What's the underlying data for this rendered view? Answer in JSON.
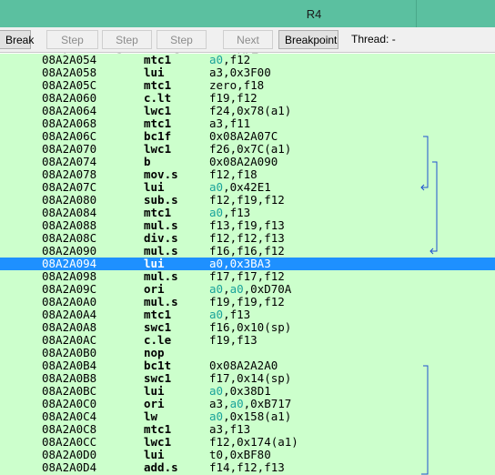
{
  "window": {
    "title": "R4"
  },
  "toolbar": {
    "break": "Break",
    "step_into": "Step Into",
    "step_over": "Step Over",
    "step_out": "Step Out",
    "next_hle": "Next HLE",
    "breakpoint": "Breakpoint",
    "thread_label": "Thread: -"
  },
  "colors": {
    "listing_bg": "#ccffcc",
    "selected_bg": "#1e90ff",
    "register": "#1aa39a",
    "arrow": "#2050d0",
    "titlebar": "#5bc0a0"
  },
  "rows": [
    {
      "addr": "08A2A054",
      "mn": "mtc1",
      "ops": [
        {
          "t": "a0",
          "r": true
        },
        {
          "t": ",f12"
        }
      ]
    },
    {
      "addr": "08A2A058",
      "mn": "lui",
      "ops": [
        {
          "t": "a3,0x3F00"
        }
      ]
    },
    {
      "addr": "08A2A05C",
      "mn": "mtc1",
      "ops": [
        {
          "t": "zero,f18"
        }
      ]
    },
    {
      "addr": "08A2A060",
      "mn": "c.lt",
      "ops": [
        {
          "t": "f19,f12"
        }
      ]
    },
    {
      "addr": "08A2A064",
      "mn": "lwc1",
      "ops": [
        {
          "t": "f24,0x78(a1)"
        }
      ]
    },
    {
      "addr": "08A2A068",
      "mn": "mtc1",
      "ops": [
        {
          "t": "a3,f11"
        }
      ]
    },
    {
      "addr": "08A2A06C",
      "mn": "bc1f",
      "ops": [
        {
          "t": "0x08A2A07C"
        }
      ]
    },
    {
      "addr": "08A2A070",
      "mn": "lwc1",
      "ops": [
        {
          "t": "f26,0x7C(a1)"
        }
      ]
    },
    {
      "addr": "08A2A074",
      "mn": "b",
      "ops": [
        {
          "t": "0x08A2A090"
        }
      ]
    },
    {
      "addr": "08A2A078",
      "mn": "mov.s",
      "ops": [
        {
          "t": "f12,f18"
        }
      ]
    },
    {
      "addr": "08A2A07C",
      "mn": "lui",
      "ops": [
        {
          "t": "a0",
          "r": true
        },
        {
          "t": ",0x42E1"
        }
      ]
    },
    {
      "addr": "08A2A080",
      "mn": "sub.s",
      "ops": [
        {
          "t": "f12,f19,f12"
        }
      ]
    },
    {
      "addr": "08A2A084",
      "mn": "mtc1",
      "ops": [
        {
          "t": "a0",
          "r": true
        },
        {
          "t": ",f13"
        }
      ]
    },
    {
      "addr": "08A2A088",
      "mn": "mul.s",
      "ops": [
        {
          "t": "f13,f19,f13"
        }
      ]
    },
    {
      "addr": "08A2A08C",
      "mn": "div.s",
      "ops": [
        {
          "t": "f12,f12,f13"
        }
      ]
    },
    {
      "addr": "08A2A090",
      "mn": "mul.s",
      "ops": [
        {
          "t": "f16,f16,f12"
        }
      ]
    },
    {
      "addr": "08A2A094",
      "mn": "lui",
      "ops": [
        {
          "t": "a0,0x3BA3"
        }
      ],
      "selected": true
    },
    {
      "addr": "08A2A098",
      "mn": "mul.s",
      "ops": [
        {
          "t": "f17,f17,f12"
        }
      ]
    },
    {
      "addr": "08A2A09C",
      "mn": "ori",
      "ops": [
        {
          "t": "a0",
          "r": true
        },
        {
          "t": ","
        },
        {
          "t": "a0",
          "r": true
        },
        {
          "t": ",0xD70A"
        }
      ]
    },
    {
      "addr": "08A2A0A0",
      "mn": "mul.s",
      "ops": [
        {
          "t": "f19,f19,f12"
        }
      ]
    },
    {
      "addr": "08A2A0A4",
      "mn": "mtc1",
      "ops": [
        {
          "t": "a0",
          "r": true
        },
        {
          "t": ",f13"
        }
      ]
    },
    {
      "addr": "08A2A0A8",
      "mn": "swc1",
      "ops": [
        {
          "t": "f16,0x10(sp)"
        }
      ]
    },
    {
      "addr": "08A2A0AC",
      "mn": "c.le",
      "ops": [
        {
          "t": "f19,f13"
        }
      ]
    },
    {
      "addr": "08A2A0B0",
      "mn": "nop",
      "ops": []
    },
    {
      "addr": "08A2A0B4",
      "mn": "bc1t",
      "ops": [
        {
          "t": "0x08A2A2A0"
        }
      ]
    },
    {
      "addr": "08A2A0B8",
      "mn": "swc1",
      "ops": [
        {
          "t": "f17,0x14(sp)"
        }
      ]
    },
    {
      "addr": "08A2A0BC",
      "mn": "lui",
      "ops": [
        {
          "t": "a0",
          "r": true
        },
        {
          "t": ",0x38D1"
        }
      ]
    },
    {
      "addr": "08A2A0C0",
      "mn": "ori",
      "ops": [
        {
          "t": "a3,"
        },
        {
          "t": "a0",
          "r": true
        },
        {
          "t": ",0xB717"
        }
      ]
    },
    {
      "addr": "08A2A0C4",
      "mn": "lw",
      "ops": [
        {
          "t": "a0",
          "r": true
        },
        {
          "t": ",0x158(a1)"
        }
      ]
    },
    {
      "addr": "08A2A0C8",
      "mn": "mtc1",
      "ops": [
        {
          "t": "a3,f13"
        }
      ]
    },
    {
      "addr": "08A2A0CC",
      "mn": "lwc1",
      "ops": [
        {
          "t": "f12,0x174(a1)"
        }
      ]
    },
    {
      "addr": "08A2A0D0",
      "mn": "lui",
      "ops": [
        {
          "t": "t0,0xBF80"
        }
      ]
    },
    {
      "addr": "08A2A0D4",
      "mn": "add.s",
      "ops": [
        {
          "t": "f14,f12,f13"
        }
      ]
    }
  ],
  "branch_arrows": [
    {
      "from_row": 6,
      "to_row": 10
    },
    {
      "from_row": 8,
      "to_row": 15
    },
    {
      "from_row": 24,
      "to_row": 33
    }
  ]
}
